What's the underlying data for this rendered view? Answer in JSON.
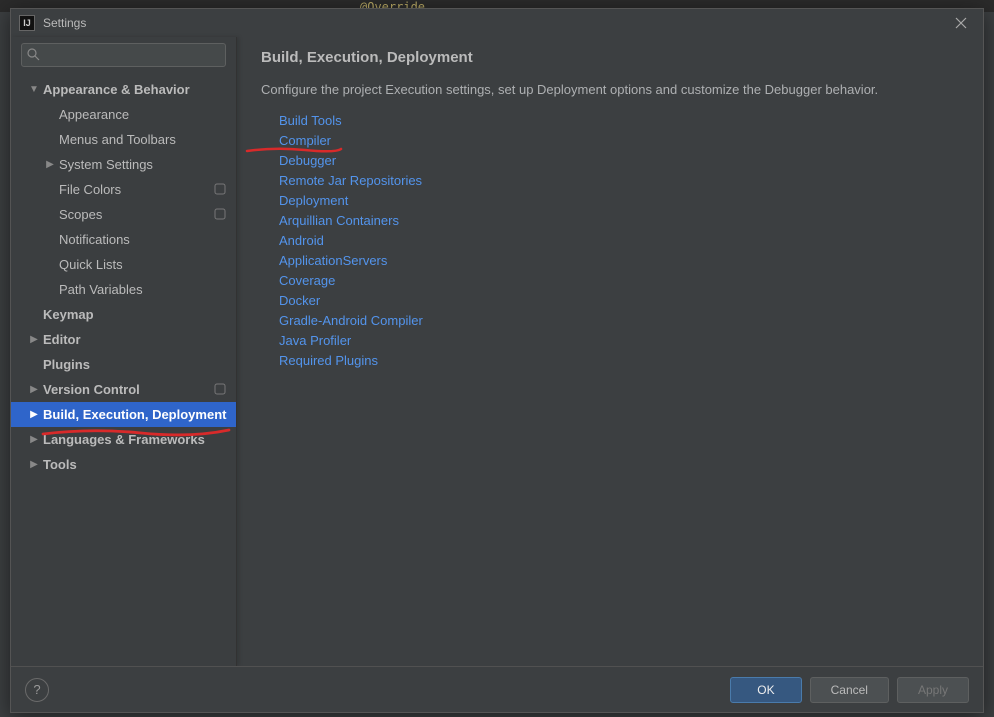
{
  "bg_code": "@Override",
  "window": {
    "title": "Settings"
  },
  "search": {
    "placeholder": ""
  },
  "sidebar": {
    "appearance_behavior": "Appearance & Behavior",
    "appearance": "Appearance",
    "menus_toolbars": "Menus and Toolbars",
    "system_settings": "System Settings",
    "file_colors": "File Colors",
    "scopes": "Scopes",
    "notifications": "Notifications",
    "quick_lists": "Quick Lists",
    "path_variables": "Path Variables",
    "keymap": "Keymap",
    "editor": "Editor",
    "plugins": "Plugins",
    "version_control": "Version Control",
    "build_execution": "Build, Execution, Deployment",
    "languages_frameworks": "Languages & Frameworks",
    "tools": "Tools"
  },
  "main": {
    "title": "Build, Execution, Deployment",
    "description": "Configure the project Execution settings, set up Deployment options and customize the Debugger behavior.",
    "links": {
      "build_tools": "Build Tools",
      "compiler": "Compiler",
      "debugger": "Debugger",
      "remote_jar": "Remote Jar Repositories",
      "deployment": "Deployment",
      "arquillian": "Arquillian Containers",
      "android": "Android",
      "app_servers": "ApplicationServers",
      "coverage": "Coverage",
      "docker": "Docker",
      "gradle_android": "Gradle-Android Compiler",
      "java_profiler": "Java Profiler",
      "required_plugins": "Required Plugins"
    }
  },
  "footer": {
    "ok": "OK",
    "cancel": "Cancel",
    "apply": "Apply"
  }
}
